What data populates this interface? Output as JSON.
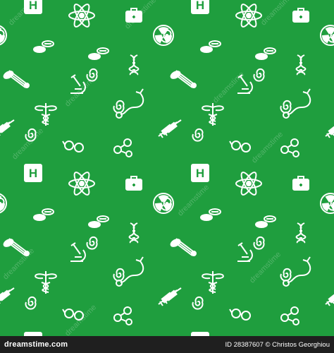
{
  "colors": {
    "background": "#1f9e3e",
    "icon": "#ffffff",
    "footer": "#1f1f1f"
  },
  "watermark": "dreamstime",
  "icons": [
    "hospital-sign-icon",
    "atom-icon",
    "medical-bag-icon",
    "radiation-icon",
    "pills-icon",
    "dna-icon",
    "thermometer-icon",
    "microscope-icon",
    "stethoscope-icon",
    "caduceus-icon",
    "syringe-icon",
    "glasses-icon",
    "molecule-icon",
    "reflex-hammer-icon",
    "spiral-icon"
  ],
  "footer": {
    "logo_text": "dreamstime.com",
    "credit": "ID 28387607 © Christos Georghiou"
  }
}
